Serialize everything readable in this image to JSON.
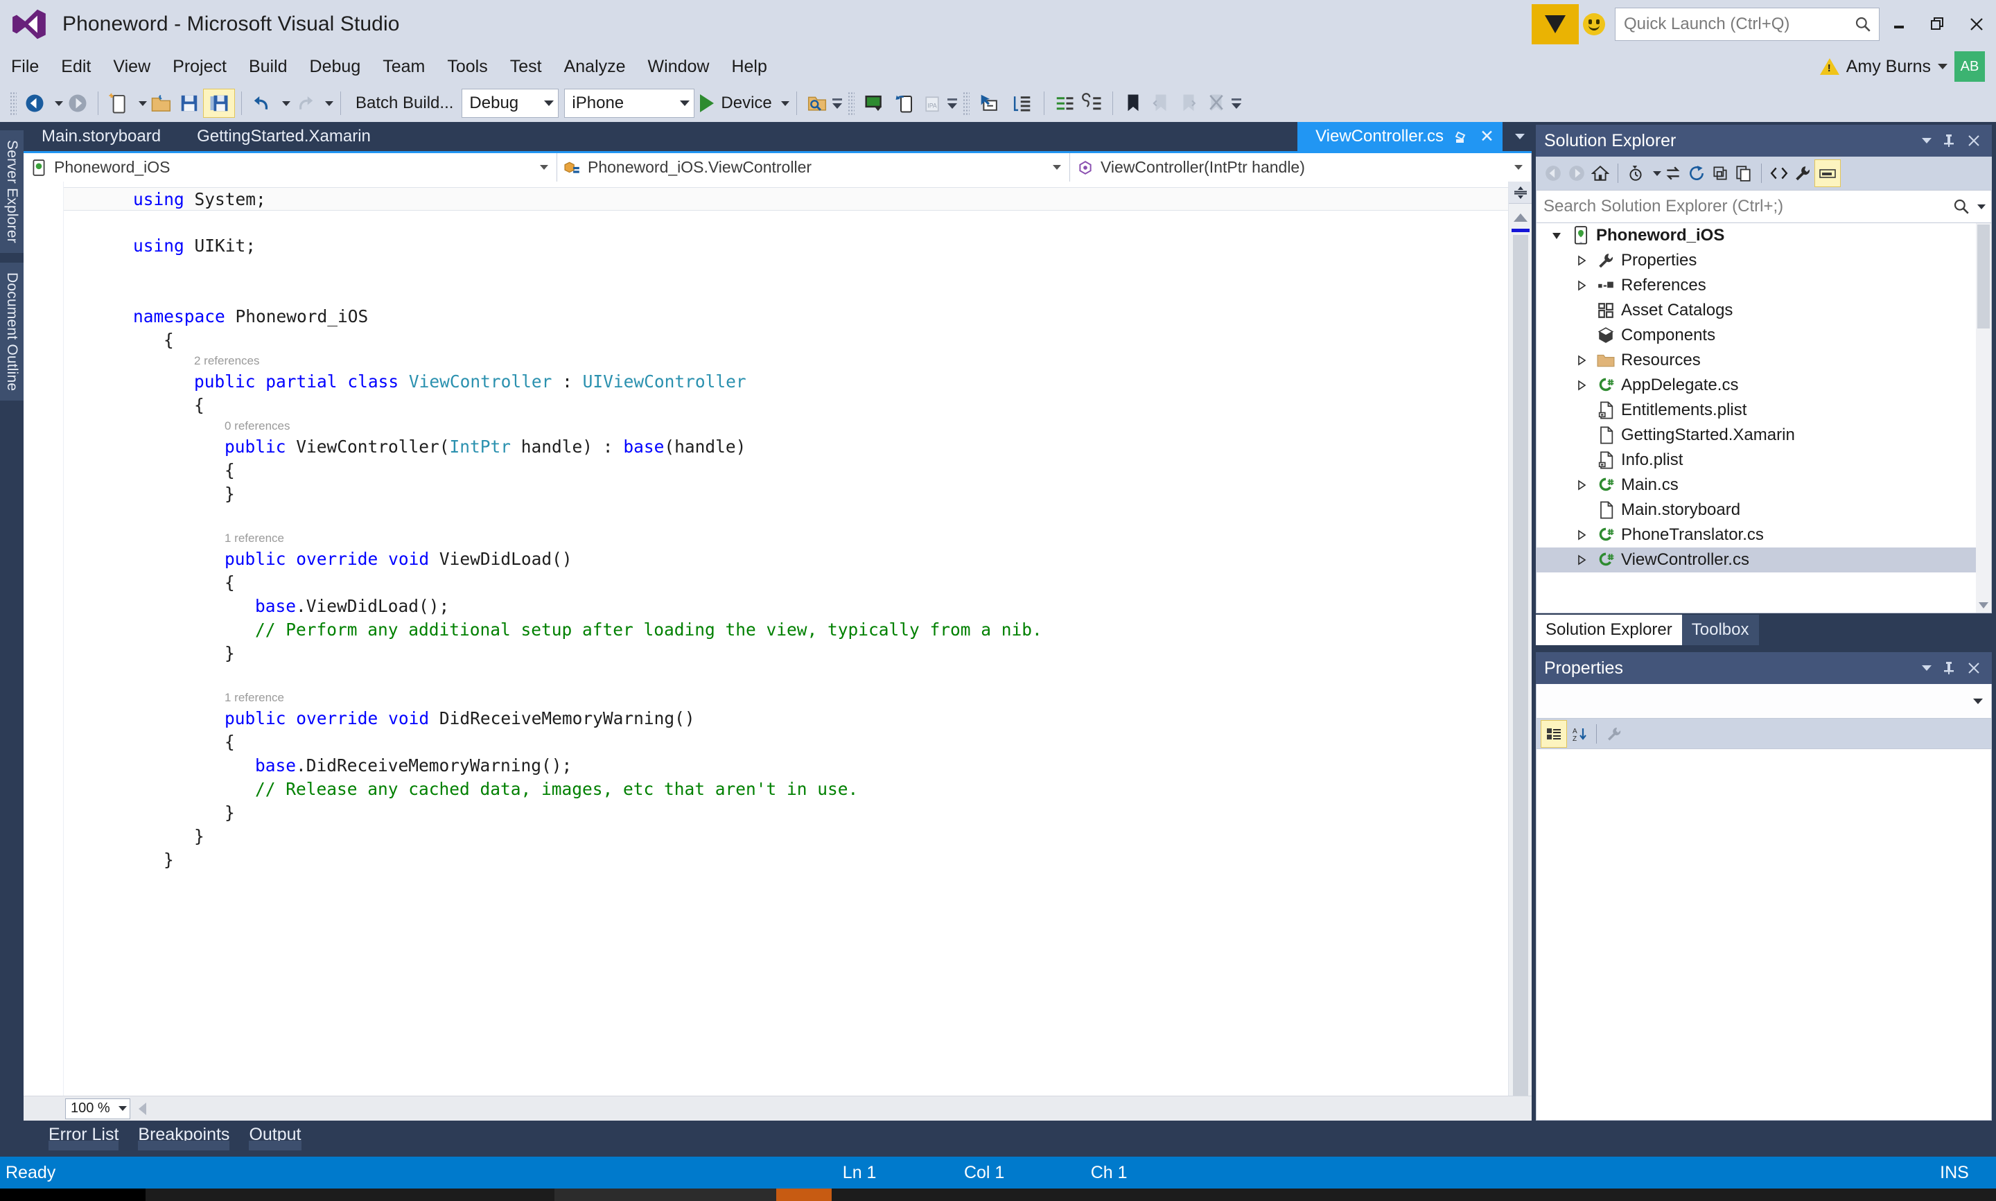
{
  "window": {
    "title": "Phoneword - Microsoft Visual Studio",
    "logo_icon": "visual-studio-logo",
    "minimize_label": "minimize-icon",
    "restore_label": "restore-icon",
    "close_label": "close-icon"
  },
  "quick_launch": {
    "placeholder": "Quick Launch (Ctrl+Q)",
    "icon": "search-icon",
    "feedback_icon": "smiley-icon",
    "flag_icon": "flag-icon"
  },
  "account": {
    "name": "Amy Burns",
    "initials": "AB",
    "warning_icon": "warning-icon"
  },
  "menubar": {
    "items": [
      "File",
      "Edit",
      "View",
      "Project",
      "Build",
      "Debug",
      "Team",
      "Tools",
      "Test",
      "Analyze",
      "Window",
      "Help"
    ]
  },
  "toolbar": {
    "batch_build_label": "Batch Build...",
    "configuration": "Debug",
    "platform": "iPhone",
    "run_target": "Device",
    "icons": [
      "navigate-back-icon",
      "navigate-forward-icon",
      "new-project-icon",
      "open-file-icon",
      "save-icon",
      "save-all-icon",
      "undo-icon",
      "redo-icon",
      "start-debug-icon",
      "find-in-files-icon",
      "ios-simulator-icon",
      "device-sync-icon",
      "ipa-package-icon",
      "pointer-window-icon",
      "indent-block-icon",
      "comment-icon",
      "uncomment-icon",
      "bookmark-icon",
      "previous-bookmark-icon",
      "next-bookmark-icon",
      "clear-bookmarks-icon"
    ]
  },
  "left_dock": {
    "tabs": [
      "Server Explorer",
      "Document Outline"
    ]
  },
  "document_tabs": {
    "items": [
      {
        "label": "Main.storyboard",
        "active": false
      },
      {
        "label": "GettingStarted.Xamarin",
        "active": false
      },
      {
        "label": "ViewController.cs",
        "active": true
      }
    ],
    "pin_icon": "pin-icon",
    "close_icon": "close-icon",
    "overflow_icon": "chevron-down-icon"
  },
  "navigation_bar": {
    "project": "Phoneword_iOS",
    "project_icon": "ios-project-icon",
    "type": "Phoneword_iOS.ViewController",
    "type_icon": "class-icon",
    "member": "ViewController(IntPtr handle)",
    "member_icon": "method-icon"
  },
  "editor": {
    "zoom": "100 %",
    "lines": [
      {
        "indent": 0,
        "fold": "minus",
        "current": true,
        "tokens": [
          {
            "t": "using",
            "c": "k"
          },
          {
            "t": " System;",
            "c": "pl"
          }
        ]
      },
      {
        "indent": 0,
        "tokens": []
      },
      {
        "indent": 0,
        "tokens": [
          {
            "t": "using",
            "c": "k"
          },
          {
            "t": " UIKit;",
            "c": "pl"
          }
        ]
      },
      {
        "indent": 0,
        "tokens": []
      },
      {
        "indent": 0,
        "tokens": []
      },
      {
        "indent": 0,
        "fold": "minus",
        "tokens": [
          {
            "t": "namespace",
            "c": "k"
          },
          {
            "t": " Phoneword_iOS",
            "c": "pl"
          }
        ]
      },
      {
        "indent": 1,
        "tokens": [
          {
            "t": "{",
            "c": "pl"
          }
        ]
      },
      {
        "indent": 2,
        "lens": "2 references"
      },
      {
        "indent": 2,
        "fold": "minus",
        "tokens": [
          {
            "t": "public",
            "c": "k"
          },
          {
            "t": " ",
            "c": "pl"
          },
          {
            "t": "partial",
            "c": "k"
          },
          {
            "t": " ",
            "c": "pl"
          },
          {
            "t": "class",
            "c": "k"
          },
          {
            "t": " ",
            "c": "pl"
          },
          {
            "t": "ViewController",
            "c": "t"
          },
          {
            "t": " : ",
            "c": "pl"
          },
          {
            "t": "UIViewController",
            "c": "t"
          }
        ]
      },
      {
        "indent": 2,
        "tokens": [
          {
            "t": "{",
            "c": "pl"
          }
        ]
      },
      {
        "indent": 3,
        "lens": "0 references"
      },
      {
        "indent": 3,
        "fold": "minus",
        "tokens": [
          {
            "t": "public",
            "c": "k"
          },
          {
            "t": " ViewController(",
            "c": "pl"
          },
          {
            "t": "IntPtr",
            "c": "t"
          },
          {
            "t": " handle) : ",
            "c": "pl"
          },
          {
            "t": "base",
            "c": "k"
          },
          {
            "t": "(handle)",
            "c": "pl"
          }
        ]
      },
      {
        "indent": 3,
        "tokens": [
          {
            "t": "{",
            "c": "pl"
          }
        ]
      },
      {
        "indent": 3,
        "tokens": [
          {
            "t": "}",
            "c": "pl"
          }
        ]
      },
      {
        "indent": 0,
        "tokens": []
      },
      {
        "indent": 3,
        "lens": "1 reference"
      },
      {
        "indent": 3,
        "fold": "minus",
        "tokens": [
          {
            "t": "public",
            "c": "k"
          },
          {
            "t": " ",
            "c": "pl"
          },
          {
            "t": "override",
            "c": "k"
          },
          {
            "t": " ",
            "c": "pl"
          },
          {
            "t": "void",
            "c": "k"
          },
          {
            "t": " ViewDidLoad()",
            "c": "pl"
          }
        ]
      },
      {
        "indent": 3,
        "tokens": [
          {
            "t": "{",
            "c": "pl"
          }
        ]
      },
      {
        "indent": 4,
        "tokens": [
          {
            "t": "base",
            "c": "k"
          },
          {
            "t": ".ViewDidLoad();",
            "c": "pl"
          }
        ]
      },
      {
        "indent": 4,
        "tokens": [
          {
            "t": "// Perform any additional setup after loading the view, typically from a nib.",
            "c": "cm"
          }
        ]
      },
      {
        "indent": 3,
        "tokens": [
          {
            "t": "}",
            "c": "pl"
          }
        ]
      },
      {
        "indent": 0,
        "tokens": []
      },
      {
        "indent": 3,
        "lens": "1 reference"
      },
      {
        "indent": 3,
        "fold": "minus",
        "tokens": [
          {
            "t": "public",
            "c": "k"
          },
          {
            "t": " ",
            "c": "pl"
          },
          {
            "t": "override",
            "c": "k"
          },
          {
            "t": " ",
            "c": "pl"
          },
          {
            "t": "void",
            "c": "k"
          },
          {
            "t": " DidReceiveMemoryWarning()",
            "c": "pl"
          }
        ]
      },
      {
        "indent": 3,
        "tokens": [
          {
            "t": "{",
            "c": "pl"
          }
        ]
      },
      {
        "indent": 4,
        "tokens": [
          {
            "t": "base",
            "c": "k"
          },
          {
            "t": ".DidReceiveMemoryWarning();",
            "c": "pl"
          }
        ]
      },
      {
        "indent": 4,
        "tokens": [
          {
            "t": "// Release any cached data, images, etc that aren't in use.",
            "c": "cm"
          }
        ]
      },
      {
        "indent": 3,
        "tokens": [
          {
            "t": "}",
            "c": "pl"
          }
        ]
      },
      {
        "indent": 2,
        "tokens": [
          {
            "t": "}",
            "c": "pl"
          }
        ]
      },
      {
        "indent": 1,
        "tokens": [
          {
            "t": "}",
            "c": "pl"
          }
        ]
      }
    ]
  },
  "solution_explorer": {
    "title": "Solution Explorer",
    "search_placeholder": "Search Solution Explorer (Ctrl+;)",
    "toolbar_icons": [
      "back-icon",
      "forward-icon",
      "home-icon",
      "pending-changes-icon",
      "sync-with-active-document-icon",
      "refresh-icon",
      "collapse-all-icon",
      "show-all-files-icon",
      "view-code-icon",
      "properties-icon",
      "preview-selected-items-icon"
    ],
    "tree": [
      {
        "label": "Phoneword_iOS",
        "depth": 0,
        "arrow": "open",
        "icon": "ios-project-icon",
        "root": true,
        "selected": false
      },
      {
        "label": "Properties",
        "depth": 1,
        "arrow": "closed",
        "icon": "wrench-icon",
        "selected": false
      },
      {
        "label": "References",
        "depth": 1,
        "arrow": "closed",
        "icon": "references-icon",
        "selected": false
      },
      {
        "label": "Asset Catalogs",
        "depth": 1,
        "arrow": "none",
        "icon": "asset-catalog-icon",
        "selected": false
      },
      {
        "label": "Components",
        "depth": 1,
        "arrow": "none",
        "icon": "components-icon",
        "selected": false
      },
      {
        "label": "Resources",
        "depth": 1,
        "arrow": "closed",
        "icon": "folder-icon",
        "selected": false
      },
      {
        "label": "AppDelegate.cs",
        "depth": 1,
        "arrow": "closed",
        "icon": "csharp-file-icon",
        "selected": false
      },
      {
        "label": "Entitlements.plist",
        "depth": 1,
        "arrow": "none",
        "icon": "plist-file-icon",
        "selected": false
      },
      {
        "label": "GettingStarted.Xamarin",
        "depth": 1,
        "arrow": "none",
        "icon": "generic-file-icon",
        "selected": false
      },
      {
        "label": "Info.plist",
        "depth": 1,
        "arrow": "none",
        "icon": "plist-file-icon",
        "selected": false
      },
      {
        "label": "Main.cs",
        "depth": 1,
        "arrow": "closed",
        "icon": "csharp-file-icon",
        "selected": false
      },
      {
        "label": "Main.storyboard",
        "depth": 1,
        "arrow": "none",
        "icon": "generic-file-icon",
        "selected": false
      },
      {
        "label": "PhoneTranslator.cs",
        "depth": 1,
        "arrow": "closed",
        "icon": "csharp-file-icon",
        "selected": false
      },
      {
        "label": "ViewController.cs",
        "depth": 1,
        "arrow": "closed",
        "icon": "csharp-file-icon",
        "selected": true
      }
    ]
  },
  "dock_tabs": [
    {
      "label": "Solution Explorer",
      "active": true
    },
    {
      "label": "Toolbox",
      "active": false
    }
  ],
  "properties_panel": {
    "title": "Properties",
    "toolbar_icons": [
      "categorized-icon",
      "alphabetical-icon",
      "property-pages-icon"
    ]
  },
  "bottom_tabs": [
    "Error List",
    "Breakpoints",
    "Output"
  ],
  "statusbar": {
    "status": "Ready",
    "line": "Ln 1",
    "column": "Col 1",
    "character": "Ch 1",
    "insert_mode": "INS"
  },
  "colors": {
    "accent_blue": "#007acc",
    "tab_active": "#2196f3",
    "chrome": "#d6dce8",
    "dock": "#2d3c56",
    "keyword": "#0000ff",
    "type": "#2b91af",
    "comment": "#008000",
    "selection": "#c7cddc"
  }
}
